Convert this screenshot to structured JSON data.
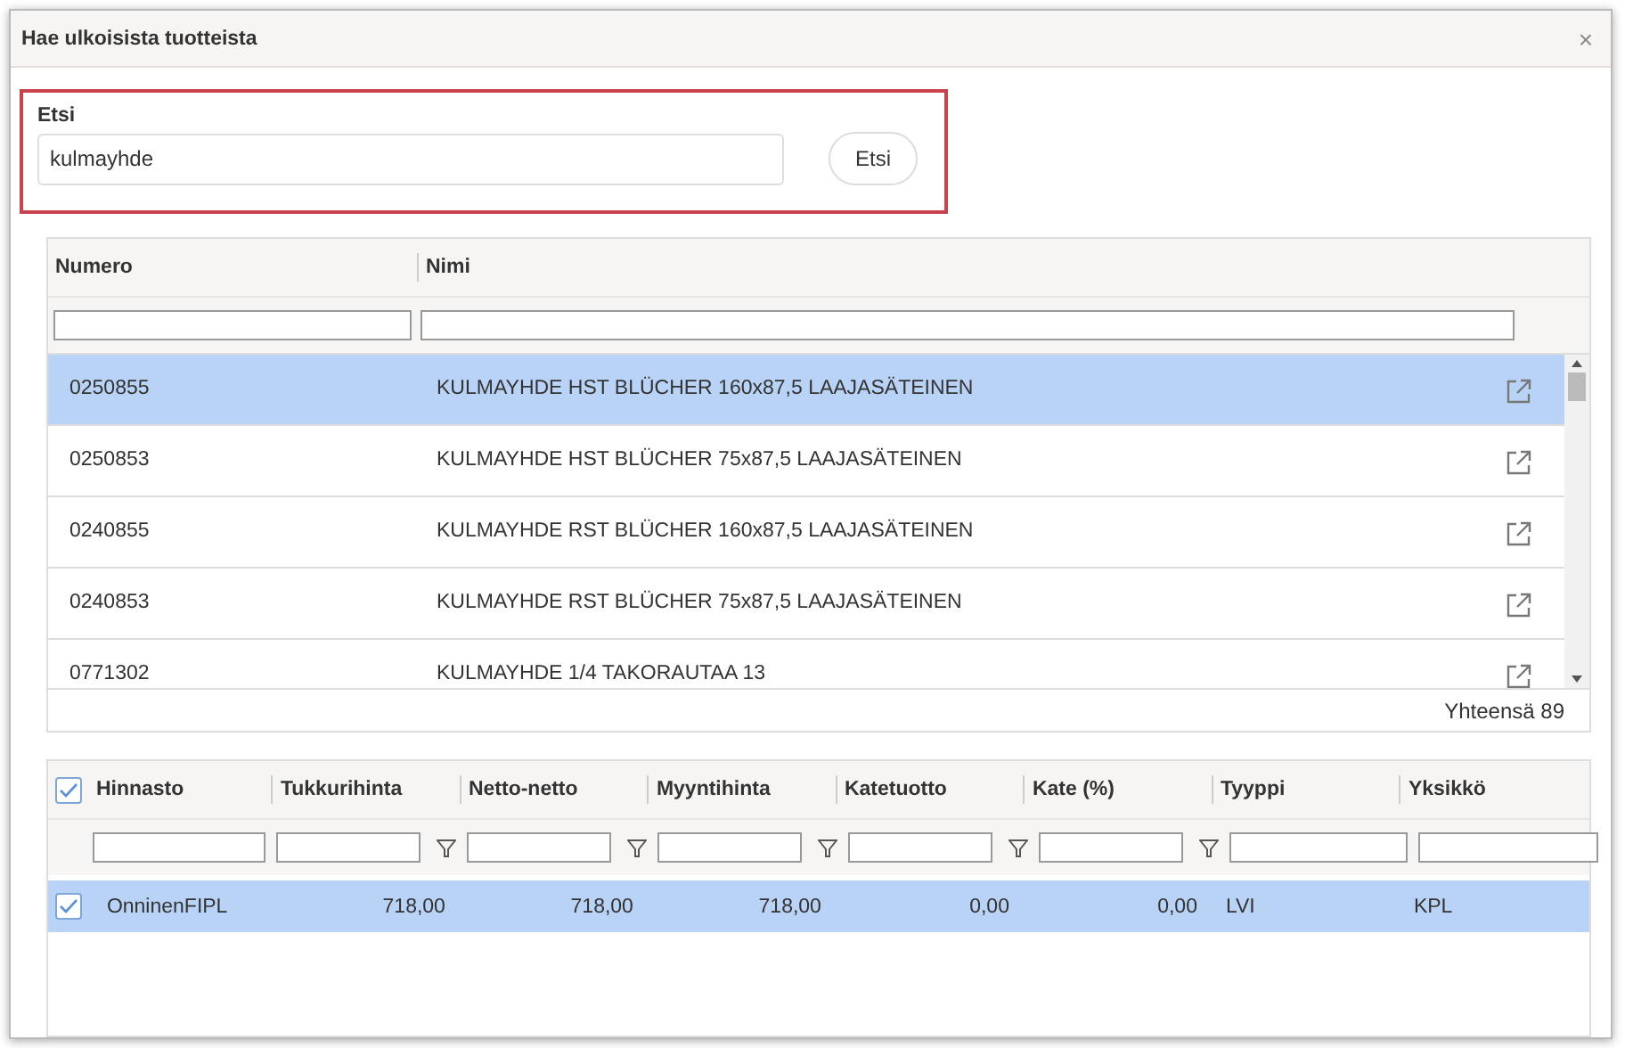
{
  "window": {
    "title": "Hae ulkoisista tuotteista",
    "close": "×"
  },
  "search": {
    "label": "Etsi",
    "value": "kulmayhde",
    "button": "Etsi"
  },
  "products": {
    "columns": [
      "Numero",
      "Nimi"
    ],
    "rows": [
      {
        "number": "0250855",
        "name": "KULMAYHDE HST BLÜCHER 160x87,5 LAAJASÄTEINEN",
        "selected": true
      },
      {
        "number": "0250853",
        "name": "KULMAYHDE HST BLÜCHER 75x87,5 LAAJASÄTEINEN",
        "selected": false
      },
      {
        "number": "0240855",
        "name": "KULMAYHDE RST BLÜCHER 160x87,5 LAAJASÄTEINEN",
        "selected": false
      },
      {
        "number": "0240853",
        "name": "KULMAYHDE RST BLÜCHER 75x87,5 LAAJASÄTEINEN",
        "selected": false
      },
      {
        "number": "0771302",
        "name": "KULMAYHDE 1/4 TAKORAUTAA 13",
        "selected": false
      }
    ],
    "total": "Yhteensä 89"
  },
  "prices": {
    "all_checked": true,
    "columns": [
      {
        "label": "Hinnasto",
        "kind": "text",
        "filter": false
      },
      {
        "label": "Tukkurihinta",
        "kind": "number",
        "filter": true
      },
      {
        "label": "Netto-netto",
        "kind": "number",
        "filter": true
      },
      {
        "label": "Myyntihinta",
        "kind": "number",
        "filter": true
      },
      {
        "label": "Katetuotto",
        "kind": "number",
        "filter": true
      },
      {
        "label": "Kate (%)",
        "kind": "number",
        "filter": true
      },
      {
        "label": "Tyyppi",
        "kind": "text",
        "filter": false
      },
      {
        "label": "Yksikkö",
        "kind": "text",
        "filter": false
      }
    ],
    "rows": [
      {
        "checked": true,
        "cells": [
          "OnninenFIPL",
          "718,00",
          "718,00",
          "718,00",
          "0,00",
          "0,00",
          "LVI",
          "KPL"
        ]
      }
    ]
  }
}
